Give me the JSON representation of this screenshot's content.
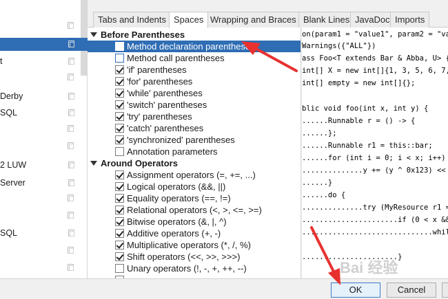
{
  "sidebar": {
    "items": [
      {
        "label": "",
        "selected": true
      },
      {
        "label": "t",
        "selected": false
      },
      {
        "label": "Derby",
        "selected": false
      },
      {
        "label": "SQL",
        "selected": false
      },
      {
        "label": "2 LUW",
        "selected": false
      },
      {
        "label": "Server",
        "selected": false
      },
      {
        "label": "SQL",
        "selected": false
      }
    ]
  },
  "tabs": [
    {
      "label": "Tabs and Indents",
      "active": false
    },
    {
      "label": "Spaces",
      "active": true
    },
    {
      "label": "Wrapping and Braces",
      "active": false
    },
    {
      "label": "Blank Lines",
      "active": false
    },
    {
      "label": "JavaDoc",
      "active": false
    },
    {
      "label": "Imports",
      "active": false
    }
  ],
  "tree": {
    "before_parentheses": {
      "title": "Before Parentheses",
      "options": [
        {
          "label": "Method declaration parentheses",
          "checked": false,
          "selected": true
        },
        {
          "label": "Method call parentheses",
          "checked": false,
          "selected": false
        },
        {
          "label": "'if' parentheses",
          "checked": true,
          "selected": false
        },
        {
          "label": "'for' parentheses",
          "checked": true,
          "selected": false
        },
        {
          "label": "'while' parentheses",
          "checked": true,
          "selected": false
        },
        {
          "label": "'switch' parentheses",
          "checked": true,
          "selected": false
        },
        {
          "label": "'try' parentheses",
          "checked": true,
          "selected": false
        },
        {
          "label": "'catch' parentheses",
          "checked": true,
          "selected": false
        },
        {
          "label": "'synchronized' parentheses",
          "checked": true,
          "selected": false
        },
        {
          "label": "Annotation parameters",
          "checked": false,
          "selected": false
        }
      ]
    },
    "around_operators": {
      "title": "Around Operators",
      "options": [
        {
          "label": "Assignment operators (=, +=, ...)",
          "checked": true
        },
        {
          "label": "Logical operators (&&, ||)",
          "checked": true
        },
        {
          "label": "Equality operators (==, !=)",
          "checked": true
        },
        {
          "label": "Relational operators (<, >, <=, >=)",
          "checked": true
        },
        {
          "label": "Bitwise operators (&, |, ^)",
          "checked": true
        },
        {
          "label": "Additive operators (+, -)",
          "checked": true
        },
        {
          "label": "Multiplicative operators (*, /, %)",
          "checked": true
        },
        {
          "label": "Shift operators (<<, >>, >>>)",
          "checked": true
        },
        {
          "label": "Unary operators (!, -, +, ++, --)",
          "checked": false
        }
      ]
    }
  },
  "code_lines": [
    "on(param1 = \"value1\", param2 = \"valu",
    "Warnings({\"ALL\"})",
    "ass Foo<T extends Bar & Abba, U> {",
    "int[] X = new int[]{1, 3, 5, 6, 7, 87",
    "int[] empty = new int[]{};",
    "",
    "blic void foo(int x, int y) {",
    "......Runnable r = () -> {",
    "......};",
    "......Runnable r1 = this::bar;",
    "......for (int i = 0; i < x; i++) {",
    "..............y += (y ^ 0x123) << 2",
    "......}",
    "......do {",
    "..............try (MyResource r1 = ",
    "......................if (0 < x && ",
    "..............................whil",
    "",
    "......................}"
  ],
  "buttons": {
    "ok": "OK",
    "cancel": "Cancel",
    "apply": "A"
  },
  "watermark": "Bai 经验",
  "colors": {
    "selection": "#2f6db5",
    "annotation_arrow": "#e8312f"
  }
}
